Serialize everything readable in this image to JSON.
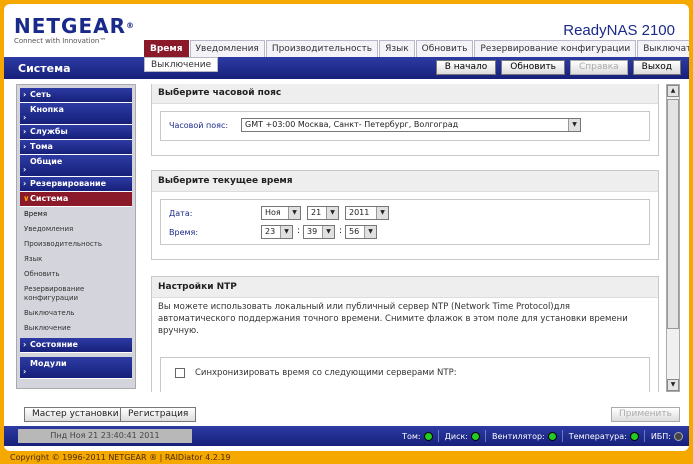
{
  "header": {
    "brand": "NETGEAR",
    "brand_mark": "®",
    "tagline": "Connect with Innovation™",
    "product": "ReadyNAS 2100"
  },
  "tabs": [
    {
      "label": "Время",
      "active": true
    },
    {
      "label": "Уведомления"
    },
    {
      "label": "Производительность"
    },
    {
      "label": "Язык"
    },
    {
      "label": "Обновить"
    },
    {
      "label": "Резервирование конфигурации"
    },
    {
      "label": "Выключатель"
    }
  ],
  "subtab": "Выключение",
  "section_title": "Система",
  "top_buttons": {
    "home": "В начало",
    "refresh": "Обновить",
    "help": "Справка",
    "logout": "Выход"
  },
  "sidebar": {
    "items": [
      {
        "label": "Сеть"
      },
      {
        "label": "Кнопка"
      },
      {
        "label": "Службы"
      },
      {
        "label": "Тома"
      },
      {
        "label": "Общие"
      },
      {
        "label": "Резервирование"
      },
      {
        "label": "Система",
        "open": true
      },
      {
        "label": "Состояние"
      },
      {
        "label": "Модули"
      }
    ],
    "sub_items": [
      "Время",
      "Уведомления",
      "Производительность",
      "Язык",
      "Обновить",
      "Резервирование конфигурации",
      "Выключатель",
      "Выключение"
    ]
  },
  "timezone": {
    "heading": "Выберите часовой пояс",
    "label": "Часовой пояс:",
    "value": "GMT +03:00 Москва, Санкт- Петербург, Волгоград"
  },
  "current_time": {
    "heading": "Выберите текущее время",
    "date_label": "Дата:",
    "time_label": "Время:",
    "month": "Ноя",
    "day": "21",
    "year": "2011",
    "hour": "23",
    "minute": "39",
    "second": "56",
    "separator": ":"
  },
  "ntp": {
    "heading": "Настройки NTP",
    "description": "Вы можете использовать локальный или публичный сервер NTP (Network Time Protocol)для автоматического поддержания точного времени. Снимите флажок в этом поле для установки времени вручную.",
    "checkbox_label": "Синхронизировать время со следующими серверами NTP:",
    "checked": false
  },
  "bottom": {
    "wizard": "Мастер установки",
    "register": "Регистрация",
    "apply": "Применить"
  },
  "status": {
    "clock": "Пнд Ноя 21  23:40:41 2011",
    "indicators": [
      {
        "label": "Том:",
        "color": "#22cc22"
      },
      {
        "label": "Диск:",
        "color": "#22cc22"
      },
      {
        "label": "Вентилятор:",
        "color": "#22cc22"
      },
      {
        "label": "Температура:",
        "color": "#22cc22"
      },
      {
        "label": "ИБП:",
        "color": "#444444"
      }
    ]
  },
  "copyright": "Copyright © 1996-2011 NETGEAR ® | RAIDiator 4.2.19",
  "icons": {
    "chevron_right": "chevron-right-icon",
    "chevron_down": "chevron-down-icon",
    "dropdown_arrow": "dropdown-arrow-icon",
    "scroll_up": "scroll-up-icon",
    "scroll_down": "scroll-down-icon"
  }
}
